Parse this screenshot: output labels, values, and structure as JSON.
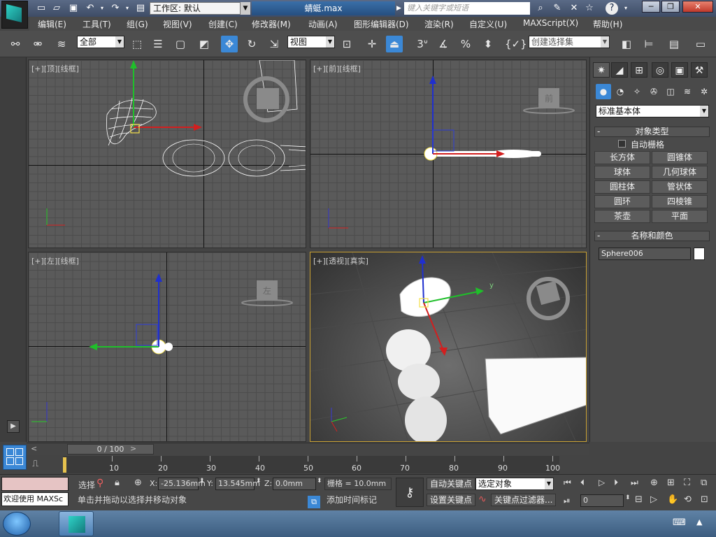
{
  "titlebar": {
    "workspace_label": "工作区: 默认",
    "filename": "蜻蜓.max",
    "search_placeholder": "键入关键字或短语"
  },
  "menus": [
    "编辑(E)",
    "工具(T)",
    "组(G)",
    "视图(V)",
    "创建(C)",
    "修改器(M)",
    "动画(A)",
    "图形编辑器(D)",
    "渲染(R)",
    "自定义(U)",
    "MAXScript(X)",
    "帮助(H)"
  ],
  "toolbar": {
    "selection_filter": "全部",
    "ref_coord": "视图",
    "snap_toggle": "3",
    "percent_snap": "%",
    "named_selection": "创建选择集"
  },
  "viewports": {
    "top": "[+][顶][线框]",
    "front": "[+][前][线框]",
    "left": "[+][左][线框]",
    "perspective": "[+][透视][真实]",
    "viewcube_front": "前",
    "viewcube_left": "左",
    "gizmo_y": "y"
  },
  "command_panel": {
    "category": "标准基本体",
    "object_type_header": "对象类型",
    "autogrid_label": "自动栅格",
    "buttons": [
      "长方体",
      "圆锥体",
      "球体",
      "几何球体",
      "圆柱体",
      "管状体",
      "圆环",
      "四棱锥",
      "茶壶",
      "平面"
    ],
    "name_color_header": "名称和颜色",
    "object_name": "Sphere006",
    "object_color": "#ffffff"
  },
  "timeline": {
    "frame_display": "0 / 100",
    "ticks": [
      "10",
      "20",
      "30",
      "40",
      "50",
      "60",
      "70",
      "80",
      "90",
      "100"
    ]
  },
  "status": {
    "welcome": "欢迎使用 MAXSc",
    "select_label": "选择",
    "x_value": "-25.136mm",
    "y_value": "13.545mm",
    "z_value": "0.0mm",
    "grid_text": "栅格 = 10.0mm",
    "prompt": "单击并拖动以选择并移动对象",
    "add_time_tag": "添加时间标记",
    "auto_key": "自动关键点",
    "set_key": "设置关键点",
    "key_mode": "选定对象",
    "key_filters": "关键点过滤器...",
    "frame_input": "0",
    "x_label": "X:",
    "y_label": "Y:",
    "z_label": "Z:"
  }
}
